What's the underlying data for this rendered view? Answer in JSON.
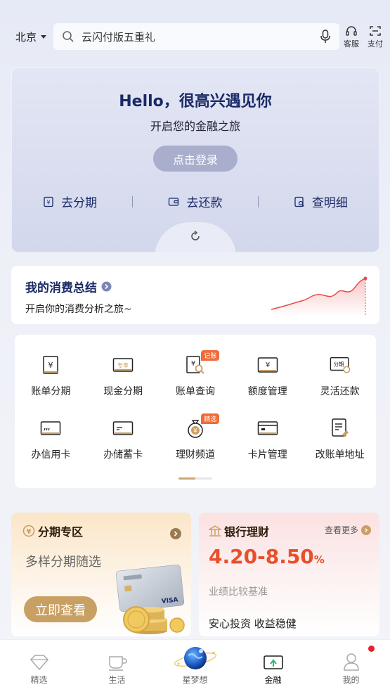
{
  "header": {
    "city": "北京",
    "search_text": "云闪付版五重礼",
    "service_label": "客服",
    "pay_label": "支付"
  },
  "hero": {
    "title": "Hello，很高兴遇见你",
    "subtitle": "开启您的金融之旅",
    "login_label": "点击登录",
    "links": [
      "去分期",
      "去还款",
      "查明细"
    ]
  },
  "summary": {
    "title": "我的消费总结",
    "subtitle": "开启你的消费分析之旅~"
  },
  "grid": {
    "items": [
      {
        "label": "账单分期",
        "icon": "bill-yuan-icon"
      },
      {
        "label": "现金分期",
        "icon": "cash-card-icon"
      },
      {
        "label": "账单查询",
        "icon": "bill-search-icon",
        "badge": "记账"
      },
      {
        "label": "额度管理",
        "icon": "quota-yuan-icon"
      },
      {
        "label": "灵活还款",
        "icon": "flexible-repay-icon"
      },
      {
        "label": "办信用卡",
        "icon": "credit-card-icon"
      },
      {
        "label": "办储蓄卡",
        "icon": "debit-card-icon"
      },
      {
        "label": "理财频道",
        "icon": "money-bag-icon",
        "badge": "精选"
      },
      {
        "label": "卡片管理",
        "icon": "card-manage-icon"
      },
      {
        "label": "改账单地址",
        "icon": "address-edit-icon"
      }
    ],
    "card_icon_texts": {
      "cash": "专享",
      "repay": "分期"
    }
  },
  "installment": {
    "title": "分期专区",
    "subtitle": "多样分期随选",
    "button": "立即查看",
    "card_brand": "VISA"
  },
  "wealth": {
    "title": "银行理财",
    "more": "查看更多",
    "rate": "4.20-8.50",
    "rate_unit": "%",
    "benchmark": "业绩比较基准",
    "slogan": "安心投资 收益稳健"
  },
  "tabbar": {
    "tabs": [
      "精选",
      "生活",
      "星梦想",
      "金融",
      "我的"
    ],
    "active": "金融"
  },
  "colors": {
    "navy": "#1a2a66",
    "gold": "#c9a063",
    "accent_red": "#e8502c"
  }
}
